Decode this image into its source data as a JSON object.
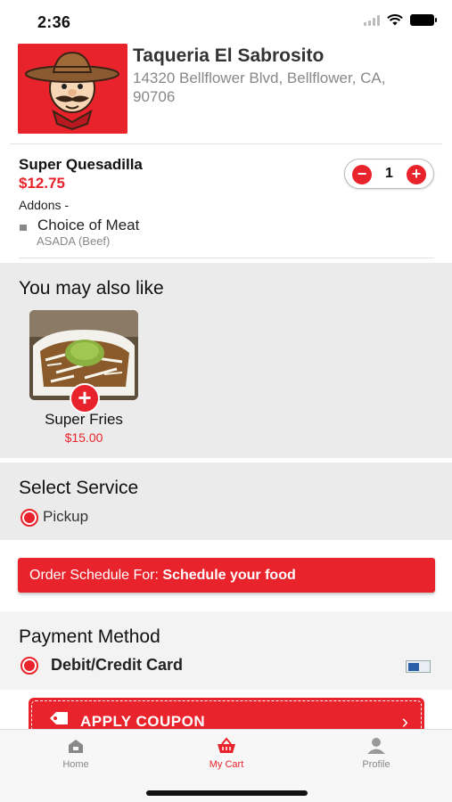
{
  "status_bar": {
    "time": "2:36"
  },
  "restaurant": {
    "name": "Taqueria El Sabrosito",
    "address": "14320 Bellflower Blvd, Bellflower, CA, 90706"
  },
  "cart_item": {
    "name": "Super Quesadilla",
    "price": "$12.75",
    "quantity": "1",
    "addons_label": "Addons -",
    "addon_name": "Choice of Meat",
    "addon_value": "ASADA (Beef)"
  },
  "suggestions": {
    "title": "You may also like",
    "items": [
      {
        "name": "Super Fries",
        "price": "$15.00",
        "add_icon": "plus"
      }
    ]
  },
  "service": {
    "title": "Select Service",
    "option": "Pickup"
  },
  "schedule": {
    "prefix": "Order Schedule For: ",
    "value": "Schedule your food"
  },
  "payment": {
    "title": "Payment Method",
    "option": "Debit/Credit Card"
  },
  "coupon": {
    "label": "APPLY COUPON"
  },
  "tab_bar": {
    "tabs": [
      {
        "label": "Home",
        "icon": "home-icon"
      },
      {
        "label": "My Cart",
        "icon": "basket-icon"
      },
      {
        "label": "Profile",
        "icon": "profile-icon"
      }
    ],
    "active": "My Cart"
  },
  "colors": {
    "accent": "#e8232b",
    "section_bg": "#ebebeb"
  }
}
